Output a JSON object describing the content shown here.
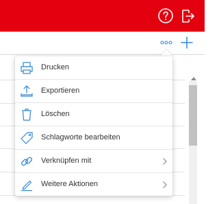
{
  "topbar": {
    "color": "#e3000f",
    "help_icon": "help-circle-icon",
    "logout_icon": "logout-icon"
  },
  "toolbar": {
    "more_icon": "more-dots-icon",
    "add_icon": "plus-icon",
    "accent": "#2f86d6"
  },
  "menu": {
    "items": [
      {
        "label": "Drucken",
        "icon": "printer-icon",
        "submenu": false
      },
      {
        "label": "Exportieren",
        "icon": "export-icon",
        "submenu": false
      },
      {
        "label": "Löschen",
        "icon": "trash-icon",
        "submenu": false
      },
      {
        "label": "Schlagworte bearbeiten",
        "icon": "tag-icon",
        "submenu": false
      },
      {
        "label": "Verknüpfen mit",
        "icon": "link-icon",
        "submenu": true
      },
      {
        "label": "Weitere Aktionen",
        "icon": "pen-icon",
        "submenu": true
      }
    ]
  }
}
